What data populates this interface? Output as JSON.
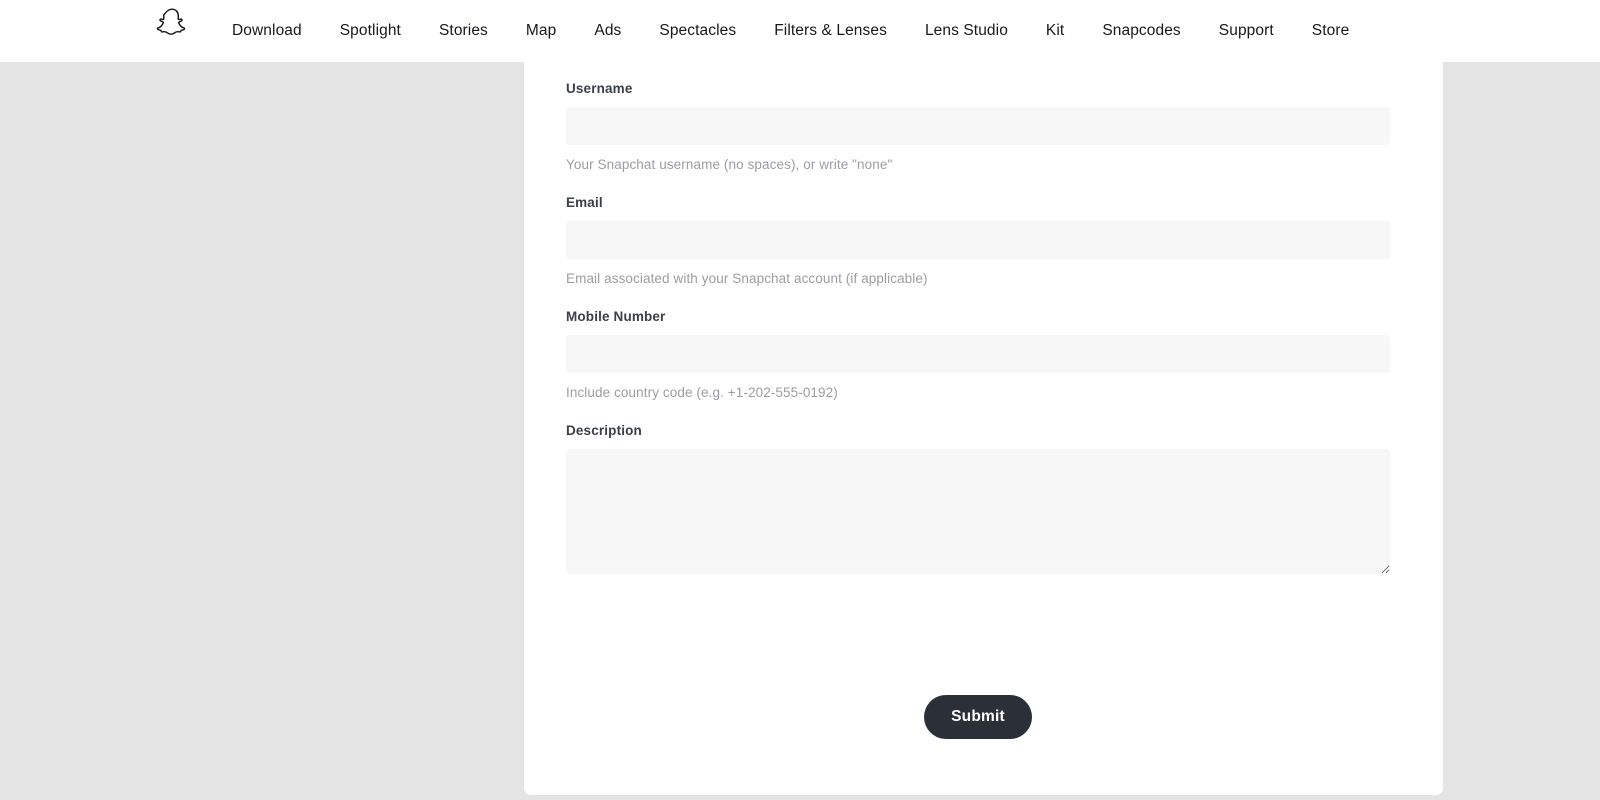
{
  "navbar": {
    "logo_icon": "snapchat-ghost-icon",
    "logo_label": "Snapchat",
    "links": [
      {
        "label": "Download"
      },
      {
        "label": "Spotlight"
      },
      {
        "label": "Stories"
      },
      {
        "label": "Map"
      },
      {
        "label": "Ads"
      },
      {
        "label": "Spectacles"
      },
      {
        "label": "Filters & Lenses"
      },
      {
        "label": "Lens Studio"
      },
      {
        "label": "Kit"
      },
      {
        "label": "Snapcodes"
      },
      {
        "label": "Support"
      },
      {
        "label": "Store"
      }
    ]
  },
  "form": {
    "fields": [
      {
        "key": "username",
        "label": "Username",
        "value": "",
        "placeholder": "",
        "hint": "Your Snapchat username (no spaces), or write \"none\"",
        "type": "text"
      },
      {
        "key": "email",
        "label": "Email",
        "value": "",
        "placeholder": "",
        "hint": "Email associated with your Snapchat account (if applicable)",
        "type": "text"
      },
      {
        "key": "mobile",
        "label": "Mobile Number",
        "value": "",
        "placeholder": "",
        "hint": "Include country code (e.g. +1-202-555-0192)",
        "type": "text"
      },
      {
        "key": "description",
        "label": "Description",
        "value": "",
        "placeholder": "",
        "hint": "",
        "type": "textarea"
      }
    ],
    "submit_label": "Submit"
  },
  "colors": {
    "page_background": "#e4e4e4",
    "card_background": "#ffffff",
    "navbar_background": "#ffffff",
    "input_background": "#f7f7f8",
    "label_text": "#3b4046",
    "hint_text": "#9b9da2",
    "nav_text": "#16191c",
    "submit_background": "#2b3038",
    "submit_text": "#ffffff"
  }
}
